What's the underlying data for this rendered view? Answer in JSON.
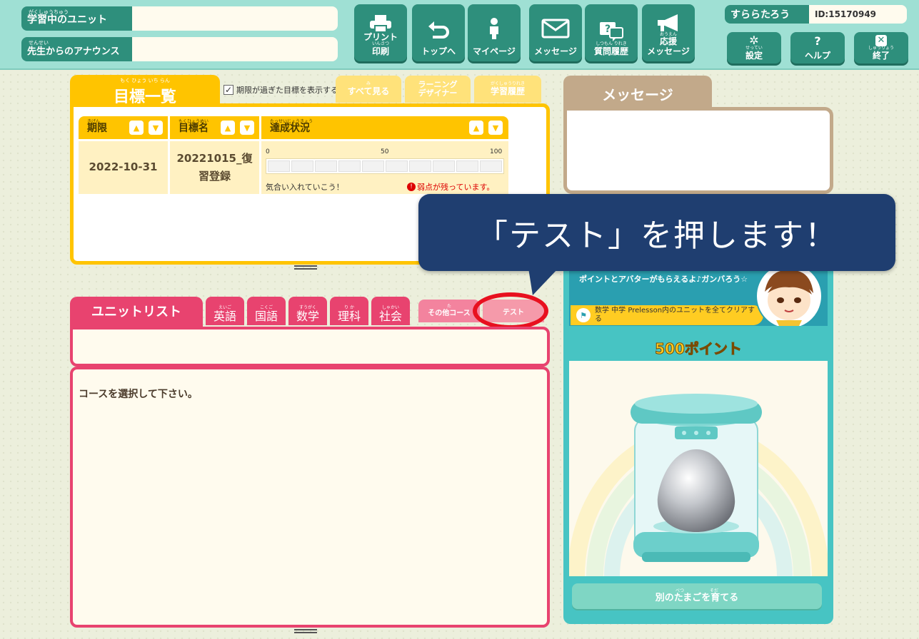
{
  "header": {
    "learning_unit": {
      "ruby": "がくしゅうちゅう",
      "label": "学習中のユニット"
    },
    "announcement": {
      "ruby": "せんせい",
      "label": "先生からのアナウンス"
    },
    "nav": [
      {
        "name": "print",
        "label": "プリント",
        "ruby": "いんさつ",
        "label2": "印刷",
        "icon": "printer-icon"
      },
      {
        "name": "top",
        "label": "トップへ",
        "icon": "return-arrow-icon"
      },
      {
        "name": "mypage",
        "label": "マイページ",
        "icon": "person-icon"
      },
      {
        "name": "message",
        "label": "メッセージ",
        "icon": "envelope-icon"
      },
      {
        "name": "question-history",
        "ruby": "しつもん りれき",
        "label": "質問履歴",
        "icon": "question-bubble-icon"
      },
      {
        "name": "cheer-message",
        "ruby": "おうえん",
        "label": "応援",
        "label2": "メッセージ",
        "icon": "megaphone-icon"
      }
    ],
    "user": {
      "name": "すららたろう",
      "id": "ID:15170949"
    },
    "settings": {
      "ruby": "せってい",
      "label": "設定"
    },
    "help": {
      "label": "ヘルプ"
    },
    "quit": {
      "ruby": "しゅうりょう",
      "label": "終了"
    }
  },
  "goals": {
    "tab_ruby": "もく ひょう いち らん",
    "tab_label": "目標一覧",
    "show_expired_label": "期限が過ぎた目標を表示する",
    "show_expired_checked": true,
    "see_all": {
      "ruby": "み",
      "label": "すべて見る"
    },
    "learning_designer": {
      "line1": "ラーニング",
      "line2": "デザイナー"
    },
    "learning_history": {
      "ruby": "がくしゅうりれき",
      "label": "学習履歴"
    },
    "columns": [
      {
        "ruby": "きげん",
        "label": "期限"
      },
      {
        "ruby": "もくひょうめい",
        "label": "目標名"
      },
      {
        "ruby": "たっせいじょうきょう",
        "label": "達成状況"
      }
    ],
    "row": {
      "deadline": "2022-10-31",
      "goal_name": "20221015_復習登録",
      "progress_value": 0,
      "scale_min": "0",
      "scale_mid": "50",
      "scale_max": "100",
      "cheer": "気合い入れていこう！",
      "warning": "弱点が残っています。"
    }
  },
  "units": {
    "tab_label": "ユニットリスト",
    "subjects": [
      {
        "ruby": "えいご",
        "label": "英語"
      },
      {
        "ruby": "こくご",
        "label": "国語"
      },
      {
        "ruby": "すうがく",
        "label": "数学"
      },
      {
        "ruby": "り か",
        "label": "理科"
      },
      {
        "ruby": "しゃかい",
        "label": "社会"
      }
    ],
    "other_course": {
      "ruby": "た",
      "label": "その他コース"
    },
    "test": {
      "label": "テスト"
    },
    "empty_message": "コースを選択して下さい。"
  },
  "messages": {
    "tab_label": "メッセージ"
  },
  "reward": {
    "text": "ポイントとアバターがもらえるよ♪ガンバろう☆",
    "mission": "数学 中学 Prelesson内のユニットを全てクリアする",
    "points": "500ポイント",
    "grow_button": {
      "ruby": "べつ　　　　　　そだ",
      "label": "別のたまごを育てる"
    }
  },
  "callout": {
    "text": "「テスト」を押します！"
  },
  "colors": {
    "header_teal": "#9fe0d4",
    "button_teal": "#2e8f7c",
    "goal_yellow": "#ffc400",
    "unit_pink": "#e8436f",
    "callout_navy": "#1f3e70",
    "highlight_red": "#e8101f"
  }
}
